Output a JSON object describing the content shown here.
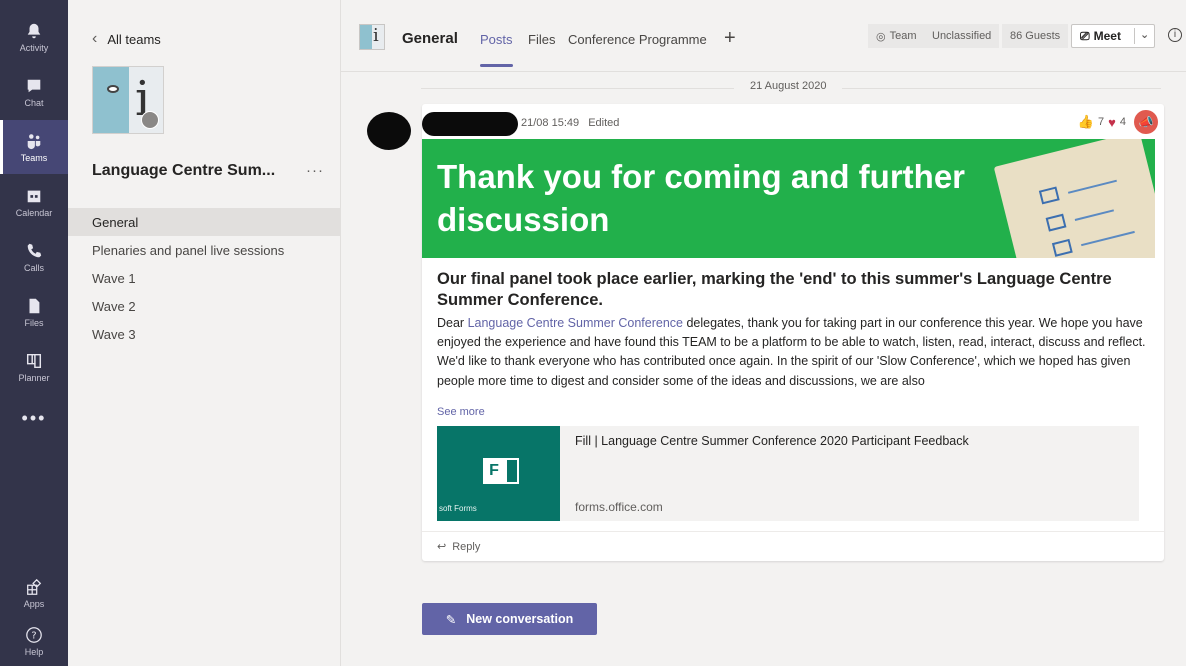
{
  "rail": {
    "items": [
      {
        "label": "Activity",
        "icon": "bell-icon"
      },
      {
        "label": "Chat",
        "icon": "chat-icon"
      },
      {
        "label": "Teams",
        "icon": "teams-icon",
        "active": true
      },
      {
        "label": "Calendar",
        "icon": "calendar-icon"
      },
      {
        "label": "Calls",
        "icon": "phone-icon"
      },
      {
        "label": "Files",
        "icon": "file-icon"
      },
      {
        "label": "Planner",
        "icon": "planner-icon"
      }
    ],
    "more": "•••",
    "apps": {
      "label": "Apps",
      "icon": "apps-icon"
    },
    "help": {
      "label": "Help",
      "icon": "help-icon"
    }
  },
  "team": {
    "back_label": "All teams",
    "name": "Language Centre Sum...",
    "more": "···",
    "channels": [
      "General",
      "Plenaries and panel live sessions",
      "Wave 1",
      "Wave 2",
      "Wave 3"
    ]
  },
  "header": {
    "logo_letter": "i",
    "title": "General",
    "tabs": [
      "Posts",
      "Files",
      "Conference Programme"
    ],
    "add_tab": "+",
    "team_label": "Team",
    "classification": "Unclassified",
    "guests": "86 Guests",
    "meet_label": "Meet",
    "info": "i"
  },
  "feed": {
    "date": "21 August 2020",
    "post": {
      "timestamp": "21/08 15:49",
      "edited": "Edited",
      "likes": "7",
      "hearts": "4",
      "banner_title": "Thank you for coming and further discussion",
      "headline": "Our final panel took place earlier, marking the 'end' to this summer's Language Centre Summer Conference.",
      "body_intro": "Dear ",
      "body_link": "Language Centre Summer Conference",
      "body_rest": " delegates, thank you for taking part in our conference this year. We hope you have enjoyed the experience and have found this TEAM to be a platform to be able to watch, listen, read, interact, discuss and reflect. We'd like to thank everyone who has contributed once again. In the spirit of our 'Slow Conference', which we hoped has given people more time to digest and consider some of the ideas and discussions, we are also",
      "see_more": "See more",
      "card": {
        "tile_label": "soft Forms",
        "tile_letter": "F",
        "title": "Fill | Language Centre Summer Conference 2020 Participant Feedback",
        "url": "forms.office.com"
      },
      "reply": "Reply"
    },
    "new_conversation": "New conversation"
  },
  "colors": {
    "accent": "#6264a7",
    "rail": "#33344a",
    "banner": "#22b04b",
    "forms_tile": "#077568"
  }
}
